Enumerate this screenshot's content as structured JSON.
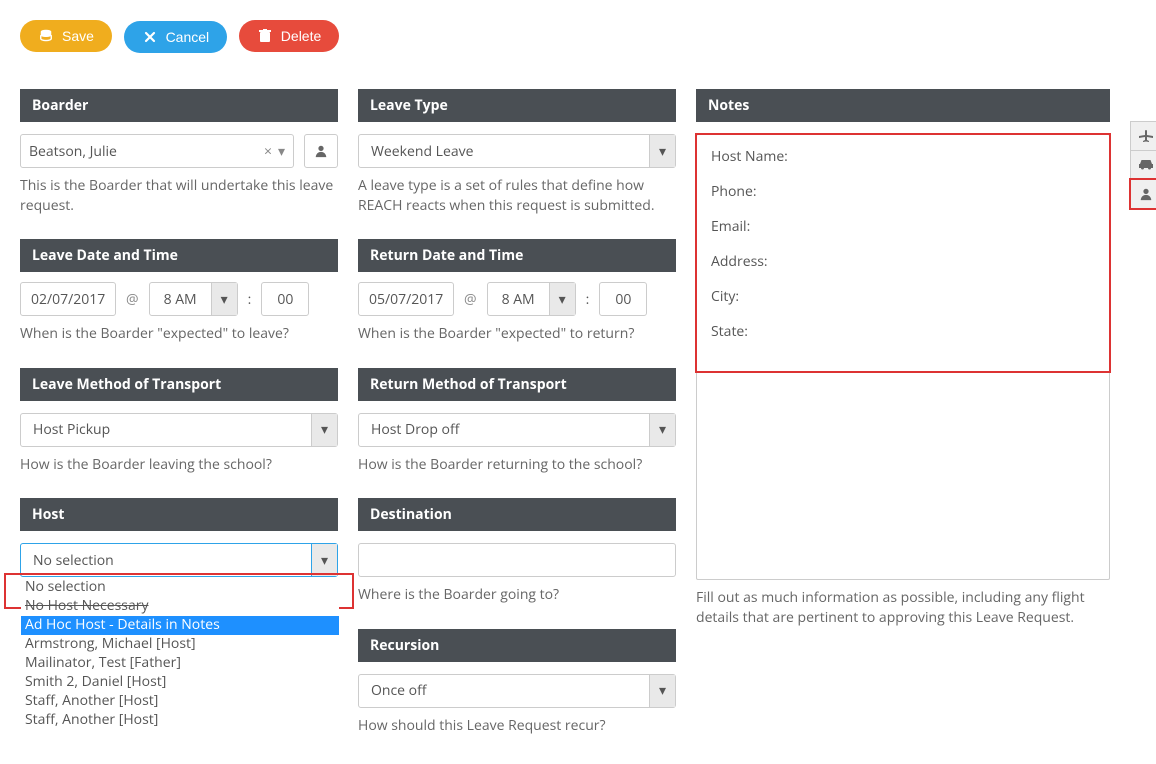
{
  "toolbar": {
    "save": "Save",
    "cancel": "Cancel",
    "delete": "Delete"
  },
  "boarder": {
    "header": "Boarder",
    "value": "Beatson, Julie",
    "help": "This is the Boarder that will undertake this leave request."
  },
  "leave_type": {
    "header": "Leave Type",
    "value": "Weekend Leave",
    "help": "A leave type is a set of rules that define how REACH reacts when this request is submitted."
  },
  "leave_dt": {
    "header": "Leave Date and Time",
    "date": "02/07/2017",
    "at": "@",
    "hour": "8 AM",
    "colon": ":",
    "minute": "00",
    "help": "When is the Boarder \"expected\" to leave?"
  },
  "return_dt": {
    "header": "Return Date and Time",
    "date": "05/07/2017",
    "at": "@",
    "hour": "8 AM",
    "colon": ":",
    "minute": "00",
    "help": "When is the Boarder \"expected\" to return?"
  },
  "leave_method": {
    "header": "Leave Method of Transport",
    "value": "Host Pickup",
    "help": "How is the Boarder leaving the school?"
  },
  "return_method": {
    "header": "Return Method of Transport",
    "value": "Host Drop off",
    "help": "How is the Boarder returning to the school?"
  },
  "host": {
    "header": "Host",
    "value": "No selection",
    "options": [
      "No selection",
      "No Host Necessary",
      "Ad Hoc Host - Details in Notes",
      "Armstrong, Michael [Host]",
      "Mailinator, Test [Father]",
      "Smith 2, Daniel [Host]",
      "Staff, Another [Host]",
      "Staff, Another [Host]"
    ],
    "highlight_index": 2
  },
  "destination": {
    "header": "Destination",
    "value": "",
    "help": "Where is the Boarder going to?"
  },
  "recursion": {
    "header": "Recursion",
    "value": "Once off",
    "help": "How should this Leave Request recur?"
  },
  "notes": {
    "header": "Notes",
    "fields": {
      "host_name": "Host Name:",
      "phone": "Phone:",
      "email": "Email:",
      "address": "Address:",
      "city": "City:",
      "state": "State:"
    },
    "help": "Fill out as much information as possible, including any flight details that are pertinent to approving this Leave Request."
  },
  "side_icons": {
    "plane": "plane-icon",
    "car": "car-icon",
    "person": "person-icon"
  }
}
